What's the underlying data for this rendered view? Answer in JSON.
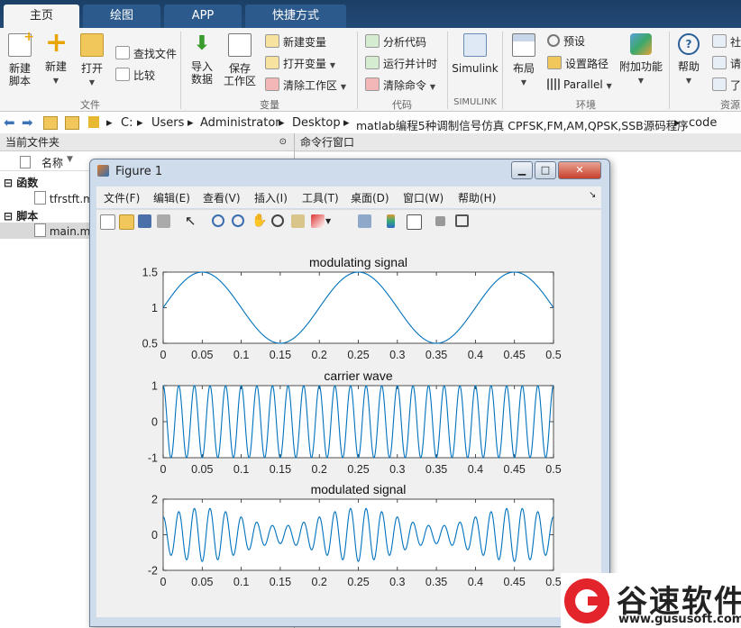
{
  "tabs": [
    "主页",
    "绘图",
    "APP",
    "快捷方式"
  ],
  "ribbon": {
    "new_script": "新建\n脚本",
    "new": "新建",
    "open": "打开",
    "find_files": "查找文件",
    "compare": "比较",
    "import_data": "导入\n数据",
    "save_workspace": "保存\n工作区",
    "new_variable": "新建变量",
    "open_variable": "打开变量",
    "clear_workspace": "清除工作区",
    "analyze_code": "分析代码",
    "run_and_time": "运行并计时",
    "clear_commands": "清除命令",
    "simulink": "Simulink",
    "layout": "布局",
    "preferences": "预设",
    "set_path": "设置路径",
    "parallel": "Parallel",
    "addons": "附加功能",
    "help": "帮助",
    "community": "社",
    "request": "请",
    "learn": "了",
    "groups": [
      "文件",
      "变量",
      "代码",
      "SIMULINK",
      "环境",
      "资源"
    ]
  },
  "address": {
    "crumbs": [
      "C:",
      "Users",
      "Administrator",
      "Desktop",
      "matlab编程5种调制信号仿真 CPFSK,FM,AM,QPSK,SSB源码程序",
      "code"
    ]
  },
  "file_panel": {
    "title": "当前文件夹",
    "col_name": "名称",
    "sections": [
      {
        "label": "函数",
        "files": [
          "tfrstft.m"
        ]
      },
      {
        "label": "脚本",
        "files": [
          "main.m"
        ]
      }
    ]
  },
  "command_window": {
    "title": "命令行窗口"
  },
  "figure": {
    "title": "Figure 1",
    "menu": [
      "文件(F)",
      "编辑(E)",
      "查看(V)",
      "插入(I)",
      "工具(T)",
      "桌面(D)",
      "窗口(W)",
      "帮助(H)"
    ],
    "toolbar_icons": [
      "new-figure-icon",
      "open-icon",
      "save-icon",
      "print-icon",
      "pointer-icon",
      "zoom-in-icon",
      "zoom-out-icon",
      "pan-icon",
      "rotate-icon",
      "data-cursor-icon",
      "brush-icon",
      "link-icon",
      "colorbar-icon",
      "legend-icon",
      "hide-tools-icon",
      "show-tools-icon"
    ]
  },
  "chart_data": [
    {
      "type": "line",
      "title": "modulating signal",
      "xlim": [
        0,
        0.5
      ],
      "ylim": [
        0.5,
        1.5
      ],
      "xticks": [
        "0",
        "0.05",
        "0.1",
        "0.15",
        "0.2",
        "0.25",
        "0.3",
        "0.35",
        "0.4",
        "0.45",
        "0.5"
      ],
      "yticks": [
        "0.5",
        "1",
        "1.5"
      ],
      "series": [
        {
          "function": "1+0.5*sin(2*pi*5*t)",
          "color": "#0072bd"
        }
      ]
    },
    {
      "type": "line",
      "title": "carrier wave",
      "xlim": [
        0,
        0.5
      ],
      "ylim": [
        -1,
        1
      ],
      "xticks": [
        "0",
        "0.05",
        "0.1",
        "0.15",
        "0.2",
        "0.25",
        "0.3",
        "0.35",
        "0.4",
        "0.45",
        "0.5"
      ],
      "yticks": [
        "-1",
        "0",
        "1"
      ],
      "series": [
        {
          "function": "cos(2*pi*50*t)",
          "color": "#0072bd"
        }
      ]
    },
    {
      "type": "line",
      "title": "modulated signal",
      "xlim": [
        0,
        0.5
      ],
      "ylim": [
        -2,
        2
      ],
      "xticks": [
        "0",
        "0.05",
        "0.1",
        "0.15",
        "0.2",
        "0.25",
        "0.3",
        "0.35",
        "0.4",
        "0.45",
        "0.5"
      ],
      "yticks": [
        "-2",
        "0",
        "2"
      ],
      "series": [
        {
          "function": "(1+0.5*sin(2*pi*5*t))*cos(2*pi*50*t)",
          "color": "#0072bd"
        }
      ]
    }
  ],
  "watermark": {
    "brand": "谷速软件",
    "url": "www.gususoft.com"
  }
}
